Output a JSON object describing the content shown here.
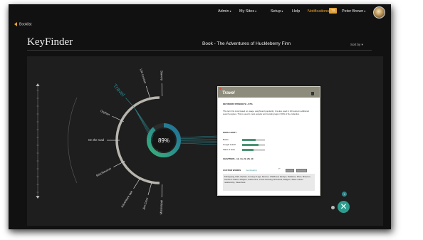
{
  "nav": {
    "admin": "Admin",
    "my_sites": "My Sites",
    "setup": "Setup",
    "help": "Help",
    "notifications": "Notifications",
    "notification_count": "73",
    "user": "Peter Brown"
  },
  "back_link": "Booklist",
  "brand": "KeyFinder",
  "book_title": "Book - The Adventures of Huckleberry Finn",
  "sort_by": "Sort by",
  "center_gauge": {
    "value_label": "89%",
    "fraction": 0.89
  },
  "keywords": [
    {
      "label": "Mississippi",
      "angle": -88
    },
    {
      "label": "Jim Crow",
      "angle": -74
    },
    {
      "label": "Adventure tale",
      "angle": -58
    },
    {
      "label": "Mischievous",
      "angle": -28
    },
    {
      "label": "On the road",
      "angle": 0
    },
    {
      "label": "Orphan",
      "angle": 25
    },
    {
      "label": "Travel",
      "angle": 48
    },
    {
      "label": "Life Lesson",
      "angle": 72
    },
    {
      "label": "Slavery",
      "angle": 88
    }
  ],
  "info_card": {
    "title": "Travel",
    "keyword_strength_label": "KEYWORD STRENGTH - 87%",
    "keyword_strength_text": "This term fits most based on usage, weight and popularity. It is also used in 23 books in additional search engines. This is used in most popular and trending tags in 50% of the collection.",
    "popularity_label": "POPULARITY",
    "popularity": [
      {
        "name": "Books",
        "fraction": 0.6
      },
      {
        "name": "Google search",
        "fraction": 0.72
      },
      {
        "name": "Sales of book",
        "fraction": 0.5
      }
    ],
    "chapters_label": "CHAPTERS - 12, 14, 22, 28, 40",
    "custom_words_label": "CUSTOM WORDS",
    "custom_tag": "riverboating",
    "custom_words_text": "Kidnapping, Raft, Orphan, Coming of age, Rescue, Childhood, Escape, Relatives, River, Missouri, Southern States, Religion, Adventures, Cross-dressing, Riverboat, Religion, Slave-master relationship, Steamboat"
  },
  "colors": {
    "accent": "#f0a22b",
    "teal": "#2b8a8f",
    "gauge_gradient_start": "#3ab07a",
    "gauge_gradient_end": "#1f6f9a",
    "arc": "#b7b5ad",
    "panel": "#1e1e1e",
    "frame": "#111111"
  },
  "icons": {
    "fab": "close-x-icon",
    "back": "left-arrow-icon",
    "card_delete": "trash-icon"
  }
}
